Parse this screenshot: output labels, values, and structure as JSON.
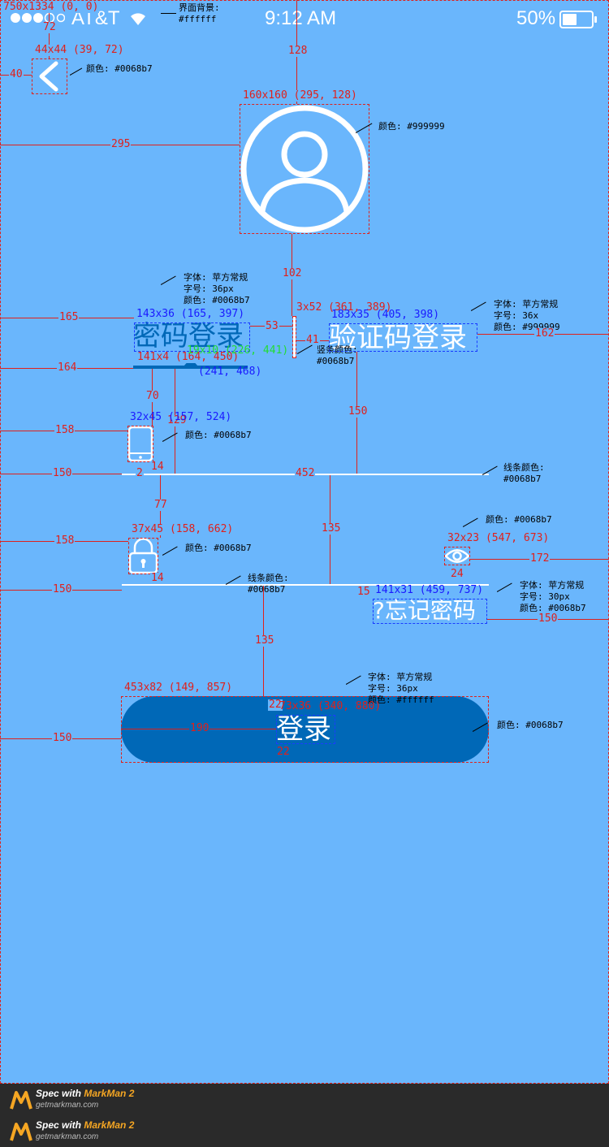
{
  "status_bar": {
    "carrier": "AT&T",
    "time": "9:12 AM",
    "battery": "50%"
  },
  "tabs": {
    "password_login": "密码登录",
    "code_login": "验证码登录"
  },
  "forgot_password": "?忘记密码",
  "login_button": "登录",
  "colors": {
    "page_background": "#6ab6fc",
    "primary": "#0068b7",
    "white": "#ffffff",
    "gray": "#999999"
  },
  "icons": {
    "back": "chevron-left-icon",
    "avatar": "user-avatar-icon",
    "phone": "phone-icon",
    "lock": "lock-icon",
    "eye": "eye-icon"
  },
  "annotations": {
    "screen": "750x1334 (0, 0)",
    "bg_note": "界面背景:\n#ffffff",
    "back_size": "44x44 (39, 72)",
    "back_color": "颜色: #0068b7",
    "d72": "72",
    "d40": "40",
    "d128": "128",
    "avatar_size": "160x160 (295, 128)",
    "avatar_color": "颜色: #999999",
    "d295": "295",
    "d102": "102",
    "tab1_font": "字体: 苹方常规\n字号: 36px\n颜色: #0068b7",
    "tab1_size": "143x36 (165, 397)",
    "d165": "165",
    "d53": "53",
    "divider_size": "3x52 (361, 389)",
    "d41": "41",
    "divider_color": "竖条颜色:\n#0068b7",
    "tab2_size": "183x35 (405, 398)",
    "tab2_font": "字体: 苹方常规\n字号: 36x\n颜色: #999999",
    "d162": "162",
    "underline_size": "141x4 (164, 450)",
    "tri_size": "19x10 (226, 441)",
    "pt241": "(241, 468)",
    "d164": "164",
    "d70": "70",
    "d129": "129",
    "d150a": "150",
    "phone_size": "32x45 (157, 524)",
    "phone_color": "颜色: #0068b7",
    "d158a": "158",
    "d14a": "14",
    "d150b": "150",
    "d2": "2",
    "d452": "452",
    "line1_color": "线条颜色:\n#0068b7",
    "d77": "77",
    "d135a": "135",
    "eye_color": "颜色: #0068b7",
    "lock_size": "37x45 (158, 662)",
    "eye_size": "32x23 (547, 673)",
    "d158b": "158",
    "lock_color": "颜色: #0068b7",
    "d172": "172",
    "d24": "24",
    "d14b": "14",
    "forgot_size": "141x31 (459, 737)",
    "forgot_font": "字体: 苹方常规\n字号: 30px\n颜色: #0068b7",
    "d150c": "150",
    "line2_color": "线条颜色:\n#0068b7",
    "d15": "15",
    "d150d": "150",
    "d135b": "135",
    "btn_size": "453x82 (149, 857)",
    "btn_font": "字体: 苹方常规\n字号: 36px\n颜色: #ffffff",
    "d22a": "22",
    "btn_text_size": "73x36 (340, 880)",
    "d190": "190",
    "btn_color": "颜色: #0068b7",
    "d22b": "22",
    "d150e": "150"
  },
  "footer": {
    "spec_with": "Spec with ",
    "brand": "MarkMan 2",
    "site": "getmarkman.com"
  }
}
